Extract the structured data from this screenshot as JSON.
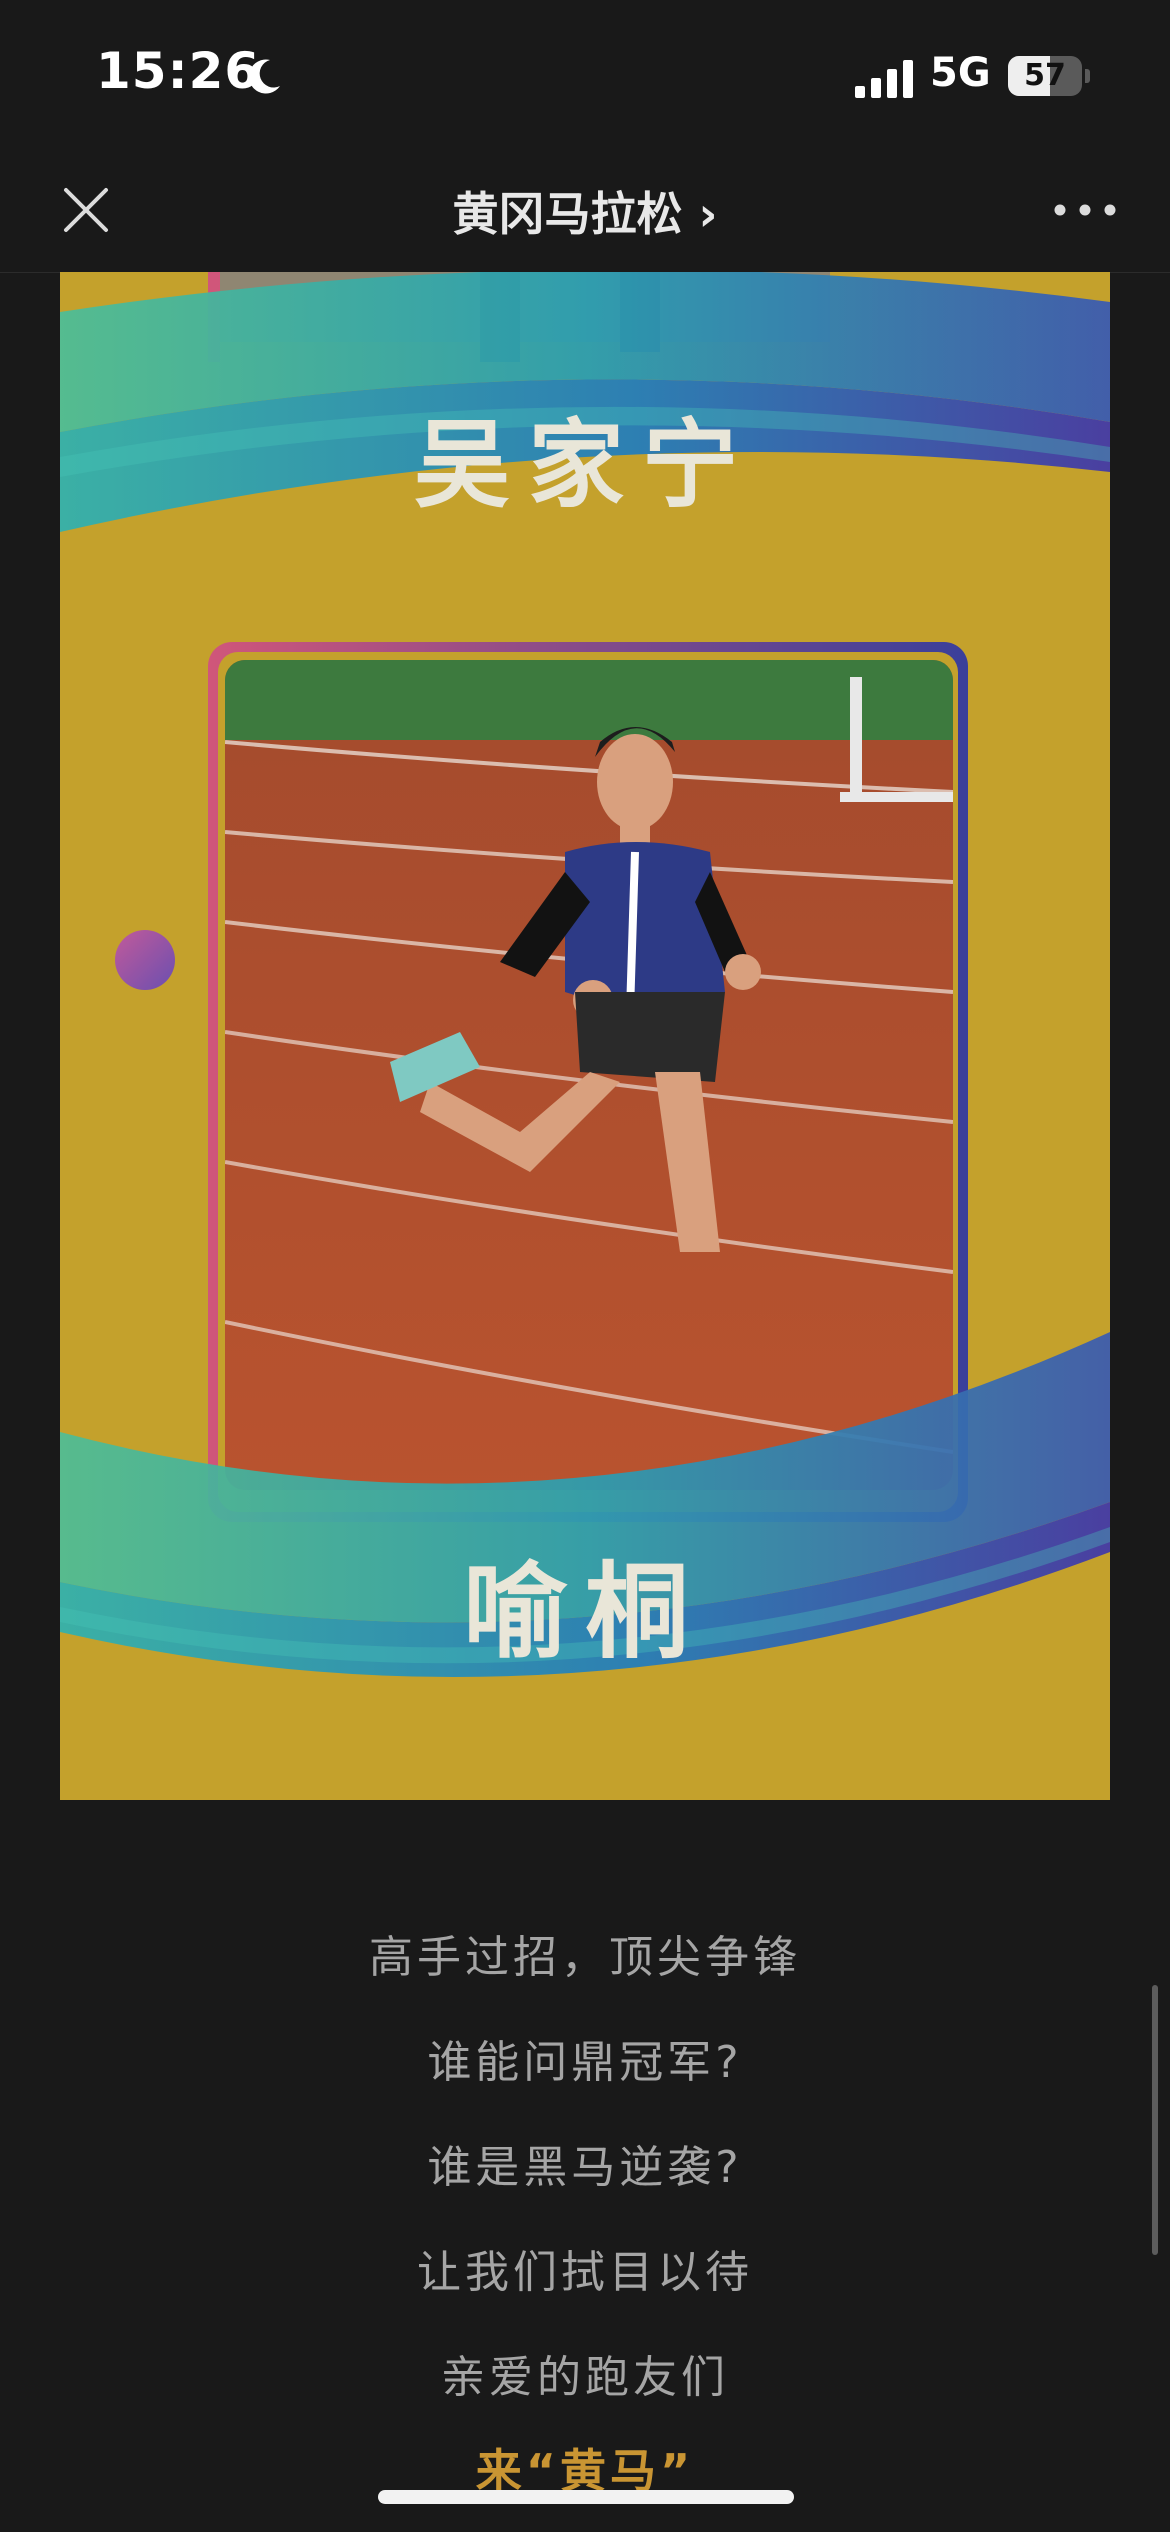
{
  "status_bar": {
    "time": "15:26",
    "network": "5G",
    "battery_level": "57"
  },
  "icons": {
    "moon": "moon-icon",
    "signal": "cellular-signal-icon",
    "battery": "battery-icon",
    "close": "close-icon",
    "more": "more-dots-icon",
    "chevron": "chevron-right-icon"
  },
  "nav": {
    "title": "黄冈马拉松 ›"
  },
  "poster": {
    "top_name": "吴家宁",
    "bottom_name": "喻桐",
    "colors": {
      "background": "#c4a12c",
      "band_teal": "#2a9fa6",
      "band_blue": "#2f4da0",
      "track": "#b8532f"
    }
  },
  "article": {
    "lines": [
      "高手过招，顶尖争锋",
      "谁能问鼎冠军?",
      "谁是黑马逆袭?",
      "让我们拭目以待",
      "亲爱的跑友们"
    ],
    "highlight": "来“黄马”",
    "highlight_color": "#c99533"
  }
}
